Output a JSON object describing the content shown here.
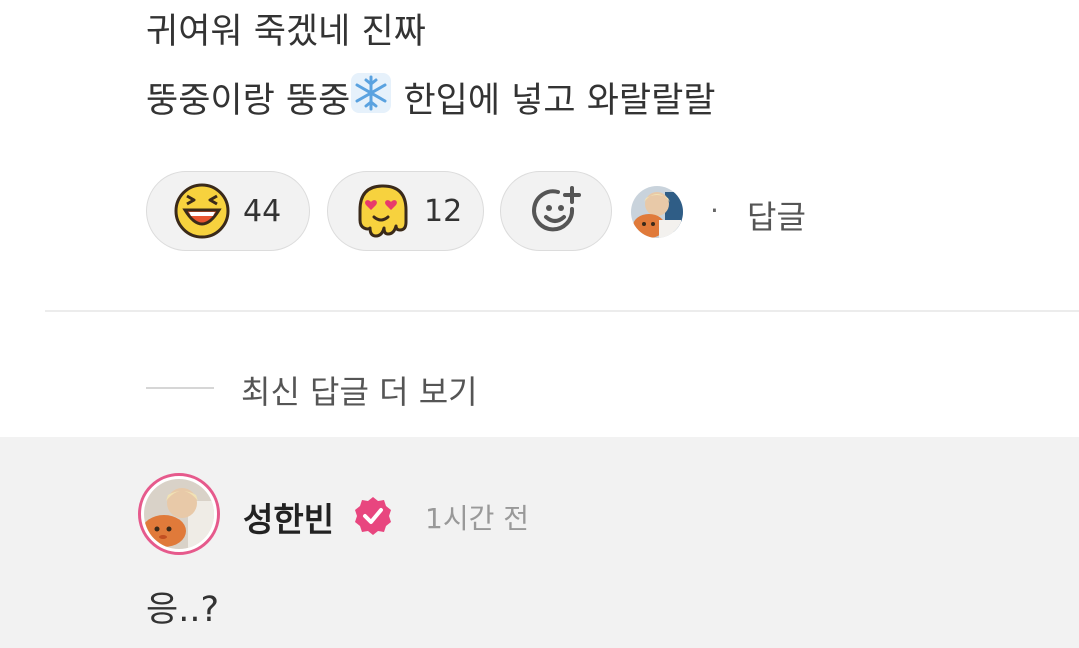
{
  "comment": {
    "line1": "귀여워 죽겠네 진짜",
    "line2_before": "뚱중이랑 뚱중",
    "line2_emoji": "snowflake-icon",
    "line2_after": " 한입에 넣고 와랄랄랄"
  },
  "reactions": [
    {
      "icon": "laughing-face-icon",
      "count": "44"
    },
    {
      "icon": "heart-eyes-melting-face-icon",
      "count": "12"
    },
    {
      "icon": "add-reaction-icon",
      "count": ""
    }
  ],
  "reply_dot": "·",
  "reply_label": "답글",
  "more_replies_label": "최신 답글 더 보기",
  "reply": {
    "author": "성한빈",
    "verified": true,
    "timestamp": "1시간 전",
    "text": "응..?"
  },
  "colors": {
    "accent_pink": "#e8467f",
    "reaction_bg": "#f2f2f2",
    "reply_bg": "#f2f2f2",
    "emoji_yellow": "#f7d23e"
  }
}
